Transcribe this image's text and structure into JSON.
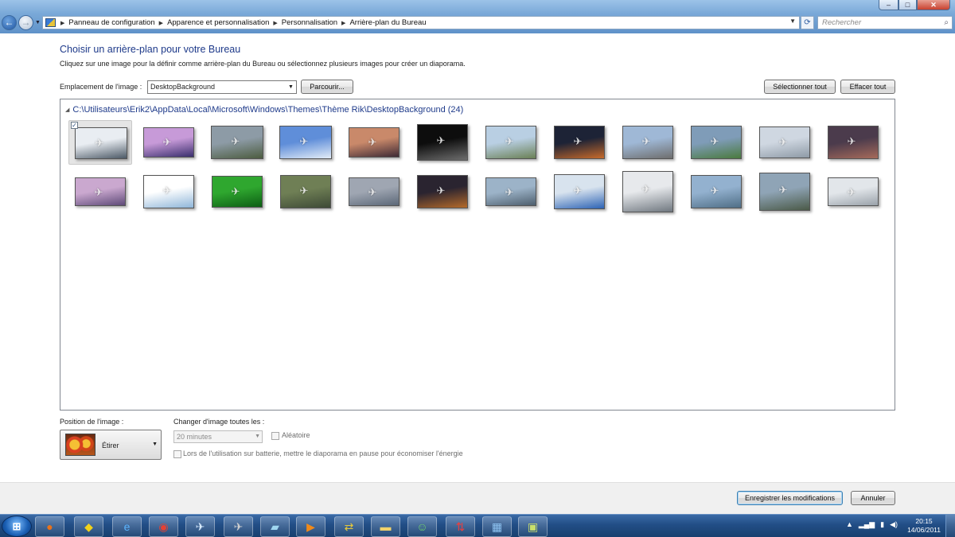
{
  "window": {
    "controls": {
      "minimize": "–",
      "maximize": "□",
      "close": "✕"
    }
  },
  "nav": {
    "back_icon": "arrow-left-icon",
    "forward_icon": "arrow-right-icon",
    "breadcrumbs": [
      "Panneau de configuration",
      "Apparence et personnalisation",
      "Personnalisation",
      "Arrière-plan du Bureau"
    ],
    "search_placeholder": "Rechercher"
  },
  "main": {
    "title": "Choisir un arrière-plan pour votre Bureau",
    "description": "Cliquez sur une image pour la définir comme arrière-plan du Bureau ou sélectionnez plusieurs images pour créer un diaporama.",
    "location_label": "Emplacement de l'image :",
    "location_value": "DesktopBackground",
    "browse_label": "Parcourir...",
    "select_all_label": "Sélectionner tout",
    "clear_all_label": "Effacer tout",
    "folder_path": "C:\\Utilisateurs\\Erik2\\AppData\\Local\\Microsoft\\Windows\\Themes\\Thème Rik\\DesktopBackground (24)",
    "thumbnails": [
      {
        "name": "wallpaper-01",
        "selected": true,
        "colors": [
          "#e9edf2",
          "#4c5966"
        ]
      },
      {
        "name": "wallpaper-02",
        "selected": false,
        "colors": [
          "#c79ad8",
          "#3a2f6e"
        ]
      },
      {
        "name": "wallpaper-03",
        "selected": false,
        "colors": [
          "#8d9ba6",
          "#4c5c40"
        ]
      },
      {
        "name": "wallpaper-04",
        "selected": false,
        "colors": [
          "#5f8ed9",
          "#e2ecf7"
        ]
      },
      {
        "name": "wallpaper-05",
        "selected": false,
        "colors": [
          "#c9896a",
          "#3e2a35"
        ]
      },
      {
        "name": "wallpaper-06",
        "selected": false,
        "colors": [
          "#0d0d0d",
          "#6d6d6d"
        ]
      },
      {
        "name": "wallpaper-07",
        "selected": false,
        "colors": [
          "#b9cfe3",
          "#6a8055"
        ]
      },
      {
        "name": "wallpaper-08",
        "selected": false,
        "colors": [
          "#1d2336",
          "#c76a2a"
        ]
      },
      {
        "name": "wallpaper-09",
        "selected": false,
        "colors": [
          "#9fb8d6",
          "#6e6e6e"
        ]
      },
      {
        "name": "wallpaper-10",
        "selected": false,
        "colors": [
          "#7f9cb8",
          "#4a7a3e"
        ]
      },
      {
        "name": "wallpaper-11",
        "selected": false,
        "colors": [
          "#cfd7e1",
          "#8e9aa6"
        ]
      },
      {
        "name": "wallpaper-12",
        "selected": false,
        "colors": [
          "#4b3b4c",
          "#a66a5a"
        ]
      },
      {
        "name": "wallpaper-13",
        "selected": false,
        "colors": [
          "#caa8cf",
          "#5e4a78"
        ]
      },
      {
        "name": "wallpaper-14",
        "selected": false,
        "colors": [
          "#ffffff",
          "#8fb6d9"
        ]
      },
      {
        "name": "wallpaper-15",
        "selected": false,
        "colors": [
          "#2fa72f",
          "#0d5e14"
        ]
      },
      {
        "name": "wallpaper-16",
        "selected": false,
        "colors": [
          "#6f7f55",
          "#3e4a36"
        ]
      },
      {
        "name": "wallpaper-17",
        "selected": false,
        "colors": [
          "#9fa6b2",
          "#5c6878"
        ]
      },
      {
        "name": "wallpaper-18",
        "selected": false,
        "colors": [
          "#2a2430",
          "#b46a2a"
        ]
      },
      {
        "name": "wallpaper-19",
        "selected": false,
        "colors": [
          "#9cb3c8",
          "#4e5f6e"
        ]
      },
      {
        "name": "wallpaper-20",
        "selected": false,
        "colors": [
          "#d8e3ee",
          "#2d63b5"
        ]
      },
      {
        "name": "wallpaper-21",
        "selected": false,
        "colors": [
          "#e7e9ec",
          "#707880"
        ]
      },
      {
        "name": "wallpaper-22",
        "selected": false,
        "colors": [
          "#93b1cf",
          "#4f6e86"
        ]
      },
      {
        "name": "wallpaper-23",
        "selected": false,
        "colors": [
          "#8fa4b6",
          "#4b5a48"
        ]
      },
      {
        "name": "wallpaper-24",
        "selected": false,
        "colors": [
          "#e2e6ea",
          "#9aa2aa"
        ]
      }
    ]
  },
  "position": {
    "label": "Position de l'image :",
    "value": "Étirer"
  },
  "slideshow": {
    "label": "Changer d'image toutes les :",
    "interval": "20 minutes",
    "shuffle_label": "Aléatoire",
    "battery_label": "Lors de l'utilisation sur batterie, mettre le diaporama en pause pour économiser l'énergie"
  },
  "footer": {
    "save_label": "Enregistrer les modifications",
    "cancel_label": "Annuler"
  },
  "taskbar": {
    "apps": [
      {
        "name": "firefox-icon",
        "glyph": "●",
        "color": "#e8731c"
      },
      {
        "name": "batman-icon",
        "glyph": "◆",
        "color": "#f2d21a"
      },
      {
        "name": "internet-explorer-icon",
        "glyph": "e",
        "color": "#5ab4ff"
      },
      {
        "name": "chrome-icon",
        "glyph": "◉",
        "color": "#e34133"
      },
      {
        "name": "airplane-app-icon",
        "glyph": "✈",
        "color": "#d9ecff"
      },
      {
        "name": "flight-sim-icon",
        "glyph": "✈",
        "color": "#d0d0d0"
      },
      {
        "name": "notepad-icon",
        "glyph": "▰",
        "color": "#9fd6f0"
      },
      {
        "name": "media-player-icon",
        "glyph": "▶",
        "color": "#f08a1a"
      },
      {
        "name": "network-icon",
        "glyph": "⇄",
        "color": "#e6c93a"
      },
      {
        "name": "explorer-folder-icon",
        "glyph": "▬",
        "color": "#f2d26a"
      },
      {
        "name": "messenger-icon",
        "glyph": "☺",
        "color": "#6fd16f"
      },
      {
        "name": "ftp-icon",
        "glyph": "⇅",
        "color": "#e84040"
      },
      {
        "name": "control-panel-icon",
        "glyph": "▦",
        "color": "#8fc4f2"
      },
      {
        "name": "picture-viewer-icon",
        "glyph": "▣",
        "color": "#c9e06a"
      }
    ],
    "time": "20:15",
    "date": "14/06/2011"
  }
}
